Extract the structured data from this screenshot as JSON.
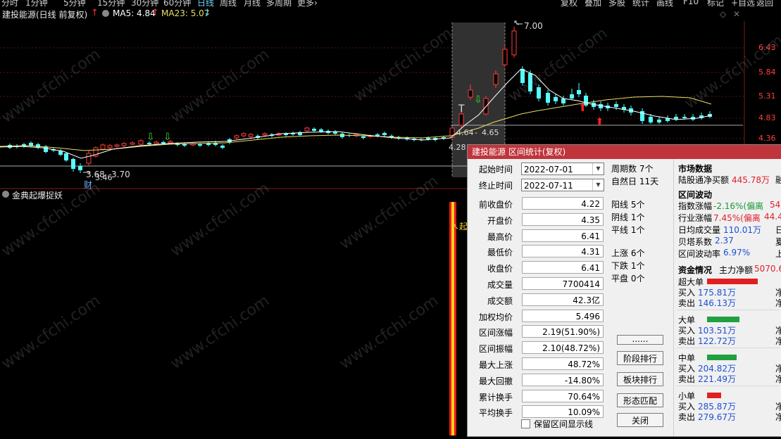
{
  "topbar": {
    "periods": [
      "分时",
      "1分钟",
      "5分钟",
      "15分钟",
      "30分钟",
      "60分钟",
      "日线",
      "周线",
      "月线",
      "多周期",
      "更多›"
    ],
    "active_period": "日线",
    "tools": [
      "复权",
      "叠加",
      "多股",
      "统计",
      "画线",
      "F10",
      "标记",
      "+自选",
      "返回"
    ]
  },
  "stock": {
    "title": "建投能源(日线 前复权)",
    "ma5_label": "MA5: 4.84",
    "ma23_label": "MA23: 5.07",
    "ma5_color": "#ffffff",
    "ma23_color": "#e8e060"
  },
  "price_axis": [
    "6.43",
    "5.84",
    "5.31",
    "4.83",
    "4.36"
  ],
  "annotations": {
    "high": "7.00",
    "low1": "3.68",
    "low2": "3.70",
    "low_small": "3.46",
    "range1": "4.64",
    "range2": "4.65",
    "start": "4.28",
    "t_mark": "T",
    "cai_mark": "财"
  },
  "indicator": {
    "title": "金典起爆捉妖",
    "marker": "↖起"
  },
  "watermark": "www.cfchi.com",
  "dialog": {
    "title": "建投能源 区间统计(复权)",
    "start_label": "起始时间",
    "start_value": "2022-07-01",
    "end_label": "终止时间",
    "end_value": "2022-07-11",
    "rows": [
      {
        "label": "前收盘价",
        "value": "4.22"
      },
      {
        "label": "开盘价",
        "value": "4.35"
      },
      {
        "label": "最高价",
        "value": "6.41"
      },
      {
        "label": "最低价",
        "value": "4.31"
      },
      {
        "label": "收盘价",
        "value": "6.41"
      },
      {
        "label": "成交量",
        "value": "7700414"
      },
      {
        "label": "成交额",
        "value": "42.3亿"
      },
      {
        "label": "加权均价",
        "value": "5.496"
      },
      {
        "label": "区间涨幅",
        "value": "2.19(51.90%)"
      },
      {
        "label": "区间振幅",
        "value": "2.10(48.72%)"
      },
      {
        "label": "最大上涨",
        "value": "48.72%"
      },
      {
        "label": "最大回撤",
        "value": "-14.80%"
      },
      {
        "label": "累计换手",
        "value": "70.64%"
      },
      {
        "label": "平均换手",
        "value": "10.09%"
      }
    ],
    "period_count": "周期数 7个",
    "natural_days": "自然日 11天",
    "yang": "阳线 5个",
    "yin": "阴线 1个",
    "flat": "平线 1个",
    "up": "上涨 6个",
    "down": "下跌 1个",
    "even": "平盘 0个",
    "more_button": "......",
    "stage_rank_button": "阶段排行",
    "sector_rank_button": "板块排行",
    "pattern_button": "形态匹配",
    "close_button": "关闭",
    "keep_checkbox": "保留区间显示线",
    "market": {
      "title": "市场数据",
      "northbound_label": "陆股通净买额",
      "northbound_value": "445.78万",
      "cut1": "融"
    },
    "volatility": {
      "title": "区间波动",
      "index_label": "指数涨幅",
      "index_value": "-2.16%(偏离",
      "index_cut": "54.0",
      "industry_label": "行业涨幅",
      "industry_value": "7.45%(偏离",
      "industry_cut": "44.44",
      "avg_vol_label": "日均成交量",
      "avg_vol_value": "110.01万",
      "avg_vol_cut": "日",
      "beta_label": "贝塔系数",
      "beta_value": "2.37",
      "beta_cut": "夏",
      "wave_label": "区间波动率",
      "wave_value": "6.97%",
      "wave_cut": "上"
    },
    "capital": {
      "title": "资金情况",
      "main_label": "主力净额",
      "main_value": "5070.6",
      "groups": [
        {
          "name": "超大单",
          "buy": "175.81万",
          "sell": "146.13万",
          "bar_color": "#e02020",
          "bar_fraction": 0.55
        },
        {
          "name": "大单",
          "buy": "103.51万",
          "sell": "122.72万",
          "bar_color": "#20a040",
          "bar_fraction": 0.35
        },
        {
          "name": "中单",
          "buy": "204.82万",
          "sell": "221.49万",
          "bar_color": "#20a040",
          "bar_fraction": 0.32
        },
        {
          "name": "小单",
          "buy": "285.87万",
          "sell": "279.67万",
          "bar_color": "#e02020",
          "bar_fraction": 0.15
        }
      ],
      "buy_label": "买入",
      "sell_label": "卖出",
      "net_cut": "净"
    }
  },
  "chart_data": {
    "type": "candlestick",
    "note_visible_only": true,
    "ylim_ticks": [
      "6.43",
      "5.84",
      "5.31",
      "4.83",
      "4.36"
    ]
  }
}
